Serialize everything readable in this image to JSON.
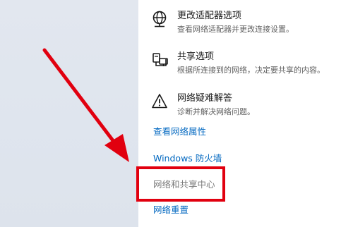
{
  "options": [
    {
      "icon": "globe-icon",
      "title": "更改适配器选项",
      "description": "查看网络适配器并更改连接设置。"
    },
    {
      "icon": "sharing-icon",
      "title": "共享选项",
      "description": "根据所连接到的网络，决定要共享的内容。"
    },
    {
      "icon": "warning-icon",
      "title": "网络疑难解答",
      "description": "诊断并解决网络问题。"
    }
  ],
  "links": {
    "view_properties": "查看网络属性",
    "firewall": "Windows 防火墙",
    "sharing_center": "网络和共享中心",
    "network_reset": "网络重置"
  },
  "colors": {
    "link": "#0067c0",
    "annotation_red": "#e1000f"
  }
}
